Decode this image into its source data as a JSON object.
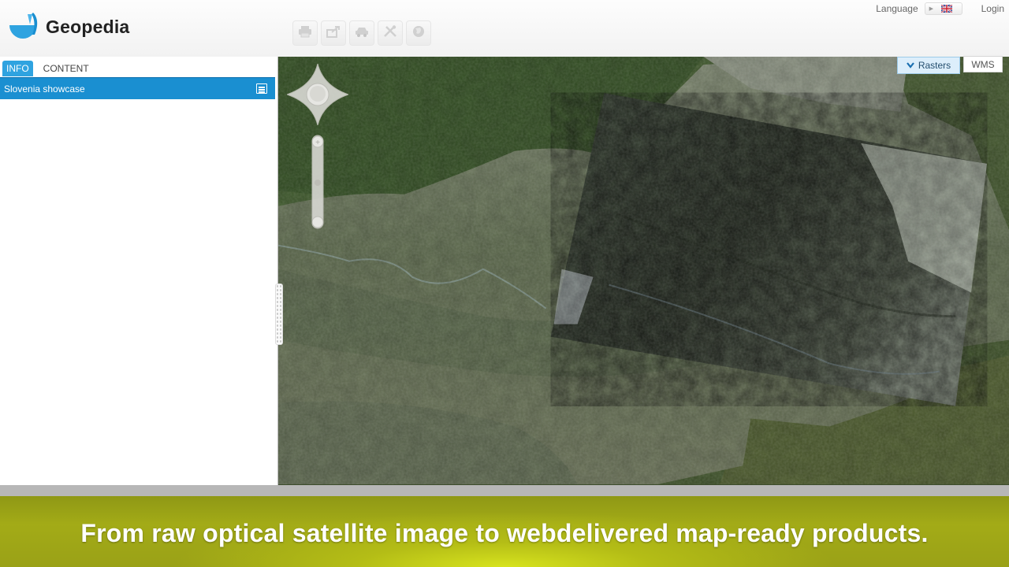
{
  "app": {
    "name": "Geopedia"
  },
  "header": {
    "language_label": "Language",
    "login_label": "Login",
    "toolbar": [
      {
        "name": "print-icon"
      },
      {
        "name": "share-icon"
      },
      {
        "name": "car-icon"
      },
      {
        "name": "tools-icon"
      },
      {
        "name": "globe-icon"
      }
    ]
  },
  "sidebar": {
    "tabs": [
      {
        "label": "INFO",
        "active": true
      },
      {
        "label": "CONTENT",
        "active": false
      }
    ],
    "project": {
      "label": "Slovenia showcase"
    }
  },
  "map": {
    "layer_buttons": {
      "rasters": "Rasters",
      "wms": "WMS"
    }
  },
  "caption": "From raw optical satellite image to webdelivered map-ready products.",
  "colors": {
    "accent": "#1a8fd1",
    "tab_active": "#2fa3e0",
    "caption_band": "#a3ab17"
  }
}
